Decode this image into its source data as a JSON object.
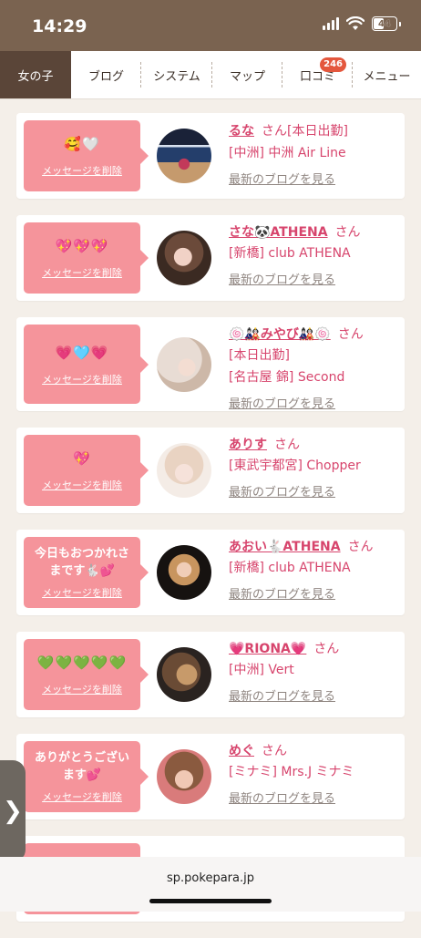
{
  "status": {
    "time": "14:29",
    "battery": "44"
  },
  "nav": {
    "items": [
      "女の子",
      "ブログ",
      "システム",
      "マップ",
      "口コミ",
      "メニュー"
    ],
    "review_badge": "246"
  },
  "honorific": "さん",
  "delete_label": "メッセージを削除",
  "blog_label": "最新のブログを見る",
  "cards": [
    {
      "message": "🥰🤍",
      "name": "るな",
      "extra": "[本日出勤]",
      "shop": "[中洲] 中洲 Air Line"
    },
    {
      "message": "💖💖💖",
      "name": "さな🐼ATHENA",
      "shop": "[新橋] club ATHENA"
    },
    {
      "message": "💗🩵💗",
      "name": "🍥🎎みやび🎎🍥",
      "extra": "[本日出勤]",
      "shop": "[名古屋 錦] Second"
    },
    {
      "message": "💖",
      "name": "ありす",
      "shop": "[東武宇都宮] Chopper"
    },
    {
      "message": "今日もおつかれさまです🐇💕",
      "name": "あおい🐇ATHENA",
      "shop": "[新橋] club ATHENA"
    },
    {
      "message": "💚💚💚💚💚",
      "name": "💗RIONA💗",
      "shop": "[中洲] Vert"
    },
    {
      "message": "ありがとうございます💕",
      "name": "めぐ",
      "shop": "[ミナミ] Mrs.J ミナミ"
    }
  ],
  "side_tab": "❯",
  "url": "sp.pokepara.jp"
}
